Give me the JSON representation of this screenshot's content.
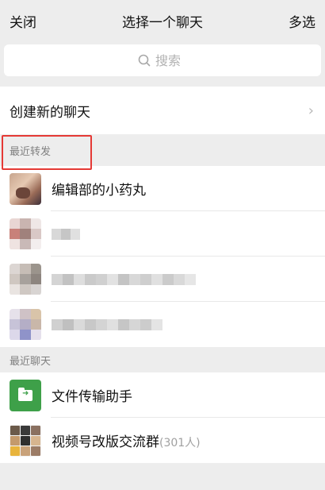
{
  "nav": {
    "close": "关闭",
    "title": "选择一个聊天",
    "multi": "多选"
  },
  "search": {
    "placeholder": "搜索"
  },
  "create": {
    "label": "创建新的聊天",
    "chevron": "›"
  },
  "sections": {
    "recent_forward": "最近转发",
    "recent_chats": "最近聊天"
  },
  "recent_forward": [
    {
      "name": "编辑部的小药丸"
    }
  ],
  "recent_chats": [
    {
      "name": "文件传输助手"
    },
    {
      "name": "视频号改版交流群",
      "count": "(301人)"
    }
  ],
  "colors": {
    "highlight": "#e53935",
    "file_icon": "#3ea049"
  },
  "icons": {
    "search": "search-icon",
    "chevron": "chevron-right-icon"
  }
}
